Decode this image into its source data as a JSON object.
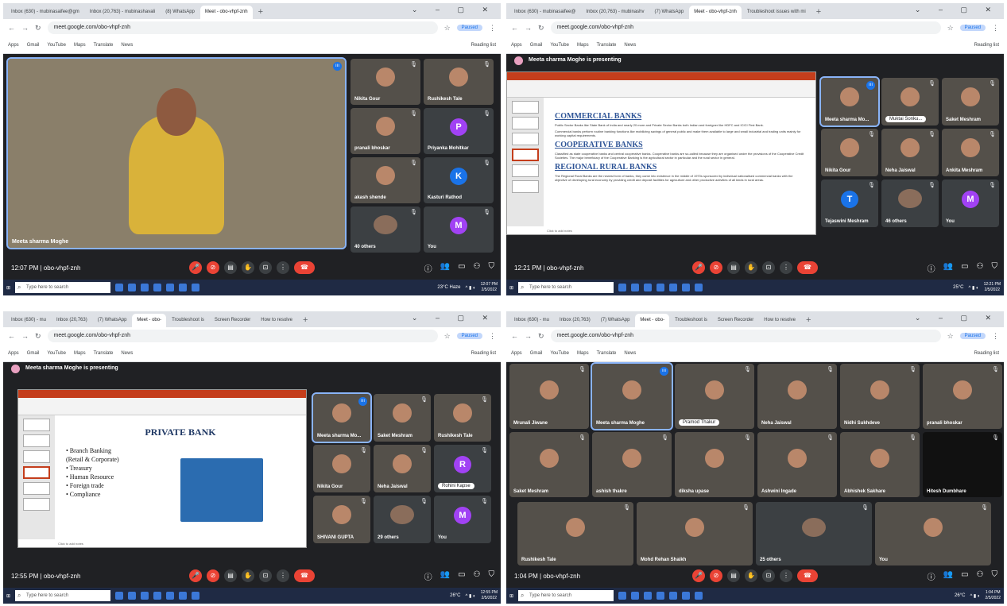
{
  "panels": [
    {
      "tabs": [
        "Inbox (630) - mubinasaifee@gm",
        "Inbox (20,763) - mubinashavali",
        "(8) WhatsApp",
        "Meet - obo-vhpf-znh"
      ],
      "url": "meet.google.com/obo-vhpf-znh",
      "paused": "Paused",
      "bookmarks": [
        "Apps",
        "Gmail",
        "YouTube",
        "Maps",
        "Translate",
        "News"
      ],
      "reading_list": "Reading list",
      "main_name": "Meeta sharma Moghe",
      "participants": [
        {
          "name": "Nikita Gour",
          "type": "cam"
        },
        {
          "name": "Rushikesh Tale",
          "type": "cam"
        },
        {
          "name": "pranali bhoskar",
          "type": "cam"
        },
        {
          "name": "Priyanka Mohitkar",
          "type": "avatar",
          "letter": "P",
          "color": "#a142f4"
        },
        {
          "name": "akash shende",
          "type": "cam"
        },
        {
          "name": "Kasturi Rathod",
          "type": "avatar",
          "letter": "K",
          "color": "#1a73e8"
        },
        {
          "name": "40 others",
          "type": "others"
        },
        {
          "name": "You",
          "type": "avatar",
          "letter": "M",
          "color": "#a142f4"
        }
      ],
      "time": "12:07 PM",
      "meeting_code": "obo-vhpf-znh",
      "taskbar_search": "Type here to search",
      "tray_weather": "23°C  Haze",
      "tray_time": "12:07 PM",
      "tray_date": "2/5/2022"
    },
    {
      "tabs": [
        "Inbox (630) - mubinasaifee@",
        "Inbox (20,763) - mubinashv",
        "(7) WhatsApp",
        "Meet - obo-vhpf-znh",
        "Troubleshoot issues with mi"
      ],
      "url": "meet.google.com/obo-vhpf-znh",
      "paused": "Paused",
      "bookmarks": [
        "Apps",
        "Gmail",
        "YouTube",
        "Maps",
        "Translate",
        "News"
      ],
      "reading_list": "Reading list",
      "presenting": "Meeta sharma Moghe is presenting",
      "slide": {
        "headings": [
          "COMMERCIAL BANKS",
          "COOPERATIVE BANKS",
          "REGIONAL RURAL BANKS"
        ],
        "bullets": [
          "Public Sector Banks like State Bank of India and nearly 20 more and Private Sector Banks both Indian and foreigner like HDFC and ICICI First Bank.",
          "Commercial banks perform routine banking functions like mobilizing savings of general public and make them available to large and small industrial and trading units mainly for working capital requirements.",
          "Classified as state cooperative banks and central cooperative banks. Cooperative banks are so-called because they are organised under the provisions of the Cooperative Credit Societies. The major beneficiary of the Cooperative Banking is the agricultural sector in particular and the rural sector in general.",
          "The Regional Rural Banks are the newest form of banks, they came into existence in the middle of 1970s sponsored by individual nationalised commercial banks with the objective of developing rural economy by providing credit and deposit facilities for agriculture and other productive activities of all kinds in rural areas."
        ],
        "notes": "Click to add notes"
      },
      "participants": [
        {
          "name": "Meeta sharma Mo...",
          "type": "cam",
          "sel": true
        },
        {
          "name": "Muktai Sonku...",
          "type": "cam",
          "chip": true
        },
        {
          "name": "Saket Meshram",
          "type": "cam"
        },
        {
          "name": "Nikita Gour",
          "type": "cam"
        },
        {
          "name": "Neha Jaiswal",
          "type": "cam"
        },
        {
          "name": "Ankita Meshram",
          "type": "cam"
        },
        {
          "name": "Tejaswini Meshram",
          "type": "avatar",
          "letter": "T",
          "color": "#1a73e8"
        },
        {
          "name": "46 others",
          "type": "others"
        },
        {
          "name": "You",
          "type": "avatar",
          "letter": "M",
          "color": "#a142f4"
        }
      ],
      "time": "12:21 PM",
      "meeting_code": "obo-vhpf-znh",
      "taskbar_search": "Type here to search",
      "tray_weather": "25°C",
      "tray_time": "12:21 PM",
      "tray_date": "2/5/2022"
    },
    {
      "tabs": [
        "Inbox (630) - mu",
        "Inbox (20,763)",
        "(7) WhatsApp",
        "Meet - obo-",
        "Troubleshoot is",
        "Screen Recorder",
        "How to resolve"
      ],
      "url": "meet.google.com/obo-vhpf-znh",
      "paused": "Paused",
      "bookmarks": [
        "Apps",
        "Gmail",
        "YouTube",
        "Maps",
        "Translate",
        "News"
      ],
      "reading_list": "Reading list",
      "presenting": "Meeta sharma Moghe is presenting",
      "slide": {
        "title": "PRIVATE BANK",
        "items": [
          "• Branch Banking",
          "(Retail & Corporate)",
          "• Treasury",
          "• Human Resource",
          "• Foreign trade",
          "• Compliance"
        ],
        "notes": "Click to add notes"
      },
      "participants": [
        {
          "name": "Meeta sharma Mo...",
          "type": "cam",
          "sel": true
        },
        {
          "name": "Saket Meshram",
          "type": "cam"
        },
        {
          "name": "Rushikesh Tale",
          "type": "cam"
        },
        {
          "name": "Nikita Gour",
          "type": "cam"
        },
        {
          "name": "Neha Jaiswal",
          "type": "cam"
        },
        {
          "name": "Rohini Kapse",
          "type": "avatar",
          "letter": "R",
          "color": "#a142f4",
          "chip": true
        },
        {
          "name": "SHIVANI GUPTA",
          "type": "cam"
        },
        {
          "name": "29 others",
          "type": "others"
        },
        {
          "name": "You",
          "type": "avatar",
          "letter": "M",
          "color": "#a142f4"
        }
      ],
      "time": "12:55 PM",
      "meeting_code": "obo-vhpf-znh",
      "taskbar_search": "Type here to search",
      "tray_weather": "26°C",
      "tray_time": "12:55 PM",
      "tray_date": "2/5/2022"
    },
    {
      "tabs": [
        "Inbox (630) - mu",
        "Inbox (20,763)",
        "(7) WhatsApp",
        "Meet - obo-",
        "Troubleshoot is",
        "Screen Recorder",
        "How to resolve"
      ],
      "url": "meet.google.com/obo-vhpf-znh",
      "paused": "Paused",
      "bookmarks": [
        "Apps",
        "Gmail",
        "YouTube",
        "Maps",
        "Translate",
        "News"
      ],
      "reading_list": "Reading list",
      "participants": [
        {
          "name": "Mrunali Jiwane",
          "type": "cam"
        },
        {
          "name": "Meeta sharma Moghe",
          "type": "cam",
          "sel": true
        },
        {
          "name": "Pramod Thakur",
          "type": "cam",
          "chip": true
        },
        {
          "name": "Neha Jaiswal",
          "type": "cam"
        },
        {
          "name": "Nidhi Sukhdeve",
          "type": "cam"
        },
        {
          "name": "pranali bhoskar",
          "type": "cam"
        },
        {
          "name": "Saket Meshram",
          "type": "cam"
        },
        {
          "name": "ashish thakre",
          "type": "cam"
        },
        {
          "name": "diksha upase",
          "type": "cam"
        },
        {
          "name": "Ashwini Ingade",
          "type": "cam"
        },
        {
          "name": "Abhishek Sakhare",
          "type": "cam"
        },
        {
          "name": "Hitesh Dumbhare",
          "type": "dark"
        },
        {
          "name": "Rushikesh Tale",
          "type": "cam"
        },
        {
          "name": "Mohd Rehan Shaikh",
          "type": "cam"
        },
        {
          "name": "25 others",
          "type": "others"
        },
        {
          "name": "You",
          "type": "cam"
        }
      ],
      "time": "1:04 PM",
      "meeting_code": "obo-vhpf-znh",
      "taskbar_search": "Type here to search",
      "tray_weather": "26°C",
      "tray_time": "1:04 PM",
      "tray_date": "2/5/2022"
    }
  ]
}
